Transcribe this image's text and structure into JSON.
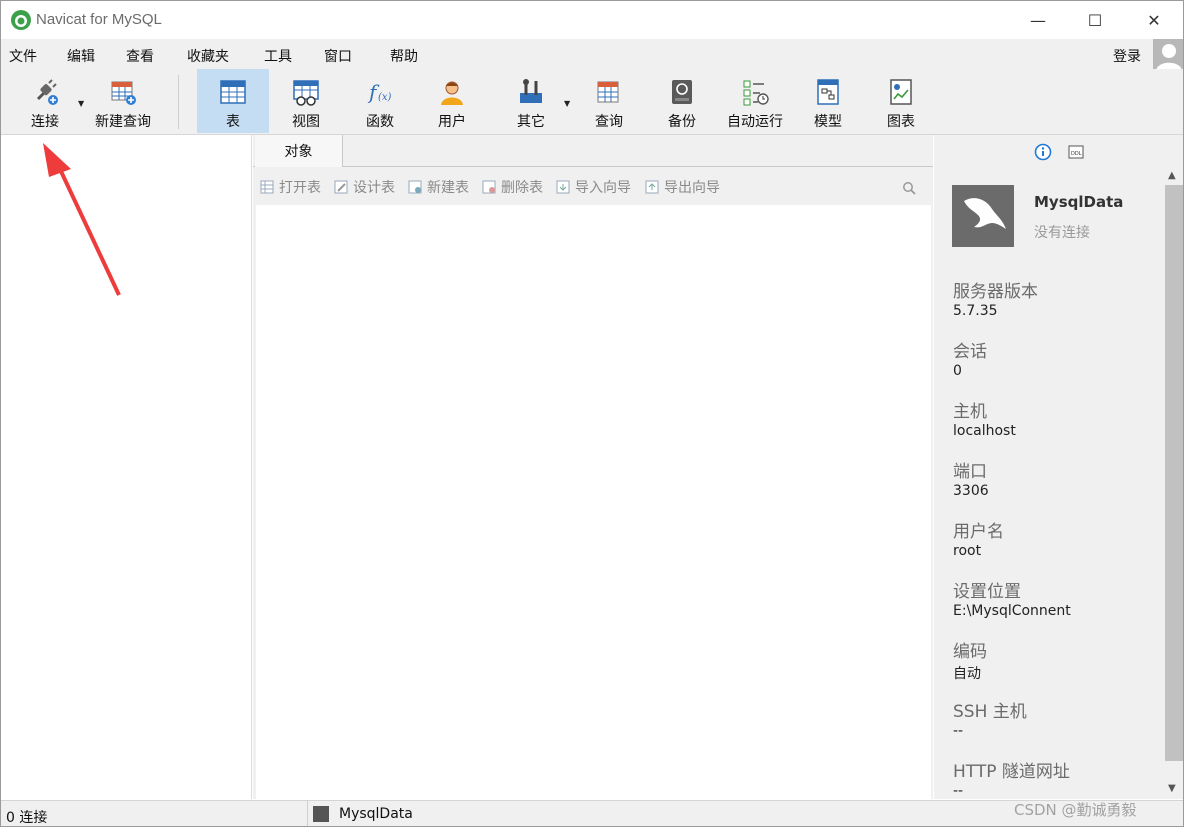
{
  "window": {
    "title": "Navicat for MySQL",
    "controls": {
      "minimize": "—",
      "maximize": "☐",
      "close": "✕"
    }
  },
  "menu": {
    "items": [
      "文件",
      "编辑",
      "查看",
      "收藏夹",
      "工具",
      "窗口",
      "帮助"
    ],
    "login": "登录"
  },
  "toolbar": {
    "items": [
      {
        "label": "连接",
        "icon": "connect-plug-icon"
      },
      {
        "label": "新建查询",
        "icon": "new-query-icon"
      },
      {
        "label": "表",
        "icon": "table-icon",
        "active": true
      },
      {
        "label": "视图",
        "icon": "view-icon"
      },
      {
        "label": "函数",
        "icon": "function-icon"
      },
      {
        "label": "用户",
        "icon": "user-icon"
      },
      {
        "label": "其它",
        "icon": "tools-icon"
      },
      {
        "label": "查询",
        "icon": "query-icon"
      },
      {
        "label": "备份",
        "icon": "backup-icon"
      },
      {
        "label": "自动运行",
        "icon": "schedule-icon"
      },
      {
        "label": "模型",
        "icon": "model-icon"
      },
      {
        "label": "图表",
        "icon": "chart-icon"
      }
    ]
  },
  "objects": {
    "tab": "对象",
    "actions": [
      "打开表",
      "设计表",
      "新建表",
      "删除表",
      "导入向导",
      "导出向导"
    ]
  },
  "info": {
    "connection_name": "MysqlData",
    "connection_status": "没有连接",
    "properties": [
      {
        "label": "服务器版本",
        "value": "5.7.35"
      },
      {
        "label": "会话",
        "value": "0"
      },
      {
        "label": "主机",
        "value": "localhost"
      },
      {
        "label": "端口",
        "value": "3306"
      },
      {
        "label": "用户名",
        "value": "root"
      },
      {
        "label": "设置位置",
        "value": "E:\\MysqlConnent"
      },
      {
        "label": "编码",
        "value": "自动"
      },
      {
        "label": "SSH 主机",
        "value": "--"
      },
      {
        "label": "HTTP 隧道网址",
        "value": "--"
      }
    ]
  },
  "status": {
    "connections": "0 连接",
    "current_connection": "MysqlData",
    "watermark": "CSDN @勤诚勇毅"
  },
  "colors": {
    "toolbar_bg": "#f0f0f0",
    "active_tab": "#c5ddf2",
    "annotation_arrow": "#ee3b3b"
  }
}
